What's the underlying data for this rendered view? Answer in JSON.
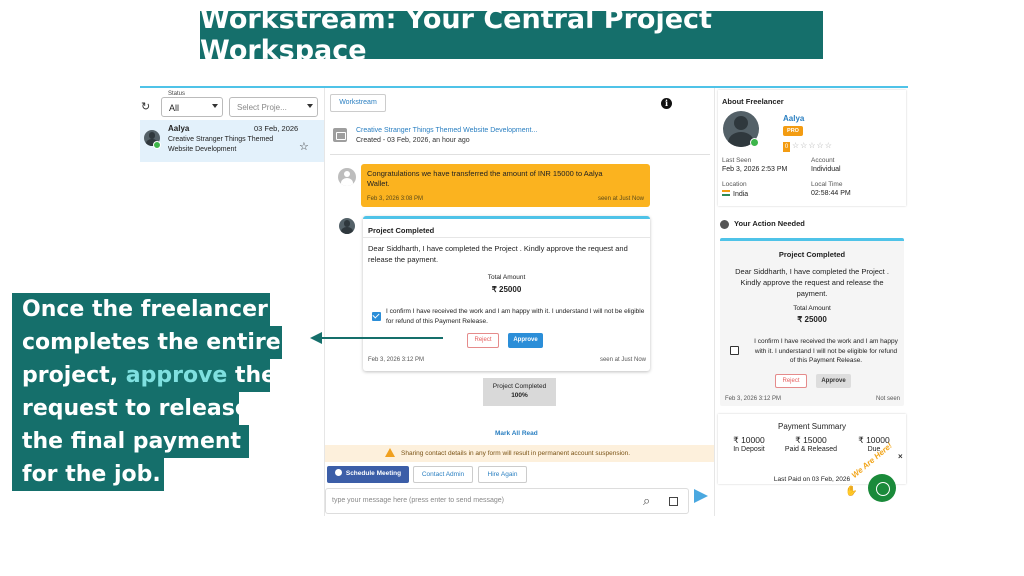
{
  "banner": {
    "title": "Workstream: Your Central Project Workspace"
  },
  "filters": {
    "status_label": "Status",
    "status_value": "All",
    "project_placeholder": "Select Proje..."
  },
  "conversation": {
    "name": "Aalya",
    "date": "03 Feb, 2026",
    "description": "Creative Stranger Things Themed Website Development"
  },
  "workspace": {
    "tab_label": "Workstream",
    "project_title": "Creative Stranger Things Themed Website Development...",
    "project_created": "Created - 03 Feb, 2026, an hour ago"
  },
  "messages": {
    "transfer": {
      "text": "Congratulations we have transferred the amount of INR 15000 to Aalya Wallet.",
      "time": "Feb 3, 2026 3:08 PM",
      "seen": "seen at Just Now"
    },
    "project_completed": {
      "title": "Project Completed",
      "body": "Dear Siddharth, I have completed the Project . Kindly approve the request and release the payment.",
      "total_label": "Total Amount",
      "total_value": "₹ 25000",
      "confirm_text": "I confirm I have received the work and I am happy with it. I understand I will not be eligible for refund of this Payment Release.",
      "reject_label": "Reject",
      "approve_label": "Approve",
      "time": "Feb 3, 2026 3:12 PM",
      "seen": "seen at Just Now"
    },
    "status_line1": "Project Completed",
    "status_line2": "100%",
    "mark_all_read": "Mark All Read"
  },
  "warning": {
    "text": "Sharing contact details in any form will result in permanent account suspension."
  },
  "actions": {
    "schedule": "Schedule Meeting",
    "contact": "Contact Admin",
    "hire": "Hire Again"
  },
  "composer": {
    "placeholder": "type your message here (press enter to send message)"
  },
  "about": {
    "title": "About Freelancer",
    "name": "Aalya",
    "badge": "PRO",
    "rating": "0",
    "stars": "☆☆☆☆☆",
    "last_seen_label": "Last Seen",
    "last_seen_value": "Feb 3, 2026 2:53 PM",
    "account_label": "Account",
    "account_value": "Individual",
    "location_label": "Location",
    "location_value": "India",
    "local_time_label": "Local Time",
    "local_time_value": "02:58:44 PM"
  },
  "action_needed": {
    "title": "Your Action Needed",
    "card_title": "Project Completed",
    "body": "Dear Siddharth, I have completed the Project . Kindly approve the request and release the payment.",
    "total_label": "Total Amount",
    "total_value": "₹ 25000",
    "confirm_text": "I confirm I have received the work and I am happy with it. I understand I will not be eligible for refund of this Payment Release.",
    "reject_label": "Reject",
    "approve_label": "Approve",
    "time": "Feb 3, 2026 3:12 PM",
    "seen": "Not seen"
  },
  "payment": {
    "title": "Payment Summary",
    "deposit_amount": "₹ 10000",
    "deposit_label": "In Deposit",
    "paid_amount": "₹ 15000",
    "paid_label": "Paid & Released",
    "due_amount": "₹ 10000",
    "due_label": "Due",
    "last_paid": "Last Paid on 03 Feb, 2026"
  },
  "chat_widget": {
    "text": "We Are Here!"
  },
  "callout": {
    "line1": "Once the freelancer",
    "line2": "completes the entire",
    "line3_pre": "project, ",
    "line3_hl": "approve",
    "line3_post": " the",
    "line4": "request to release",
    "line5": "the final payment",
    "line6": "for the job."
  },
  "colors": {
    "brand_teal": "#156f6b",
    "accent_blue": "#2b8ed8",
    "message_yellow": "#fbb31f",
    "pro_orange": "#f39c12"
  }
}
